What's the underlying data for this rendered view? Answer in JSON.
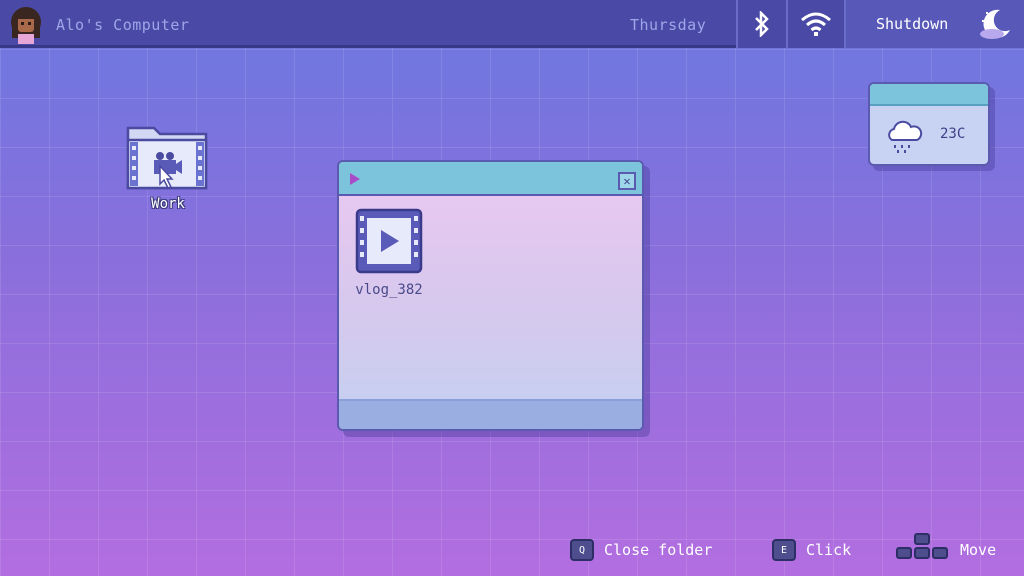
{
  "topbar": {
    "computer_name": "Alo's Computer",
    "day": "Thursday",
    "bluetooth_icon": "bluetooth-icon",
    "wifi_icon": "wifi-icon",
    "shutdown_label": "Shutdown",
    "moon_icon": "moon-icon"
  },
  "desktop": {
    "icons": [
      {
        "label": "Work",
        "icon": "video-folder-icon"
      }
    ]
  },
  "weather": {
    "temperature": "23C",
    "icon": "rain-cloud-icon"
  },
  "window": {
    "title_icon": "play-triangle-icon",
    "close_glyph": "✕",
    "files": [
      {
        "label": "vlog_382",
        "icon": "video-file-icon"
      }
    ]
  },
  "hints": {
    "close_key": "Q",
    "close_label": "Close folder",
    "click_key": "E",
    "click_label": "Click",
    "move_label": "Move"
  },
  "colors": {
    "topbar": "#4a4aa6",
    "window_title": "#7cc4dc",
    "window_border": "#5a5ab0",
    "bg_top": "#6b78e0",
    "bg_bottom": "#b26ee0"
  }
}
